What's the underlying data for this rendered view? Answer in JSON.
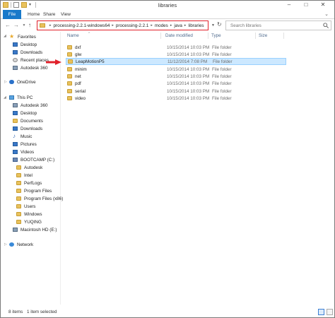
{
  "window": {
    "title": "libraries"
  },
  "ribbon": {
    "file": "File",
    "home": "Home",
    "share": "Share",
    "view": "View"
  },
  "address": {
    "crumbs": [
      "processing-2.2.1-windows64",
      "processing-2.2.1",
      "modes",
      "java",
      "libraries"
    ],
    "highlight_color": "#e0202a"
  },
  "search": {
    "placeholder": "Search libraries"
  },
  "nav": {
    "favorites": "Favorites",
    "desktop": "Desktop",
    "downloads": "Downloads",
    "recent": "Recent places",
    "autodesk360_fav": "Autodesk 360",
    "onedrive": "OneDrive",
    "thispc": "This PC",
    "autodesk360": "Autodesk 360",
    "pc_desktop": "Desktop",
    "documents": "Documents",
    "pc_downloads": "Downloads",
    "music": "Music",
    "pictures": "Pictures",
    "videos": "Videos",
    "bootcamp": "BOOTCAMP (C:)",
    "c_autodesk": "Autodesk",
    "c_intel": "Intel",
    "c_perflogs": "PerfLogs",
    "c_programfiles": "Program Files",
    "c_programfilesx86": "Program Files (x86)",
    "c_users": "Users",
    "c_windows": "Windows",
    "c_yuqing": "YUQING",
    "macintosh": "Macintosh HD (E:)",
    "network": "Network"
  },
  "columns": {
    "name": "Name",
    "date": "Date modified",
    "type": "Type",
    "size": "Size"
  },
  "files": [
    {
      "name": "dxf",
      "date": "10/15/2014 10:03 PM",
      "type": "File folder"
    },
    {
      "name": "glw",
      "date": "10/15/2014 10:03 PM",
      "type": "File folder"
    },
    {
      "name": "LeapMotionP5",
      "date": "11/12/2014 7:08 PM",
      "type": "File folder"
    },
    {
      "name": "minim",
      "date": "10/15/2014 10:03 PM",
      "type": "File folder"
    },
    {
      "name": "net",
      "date": "10/15/2014 10:03 PM",
      "type": "File folder"
    },
    {
      "name": "pdf",
      "date": "10/15/2014 10:03 PM",
      "type": "File folder"
    },
    {
      "name": "serial",
      "date": "10/15/2014 10:03 PM",
      "type": "File folder"
    },
    {
      "name": "video",
      "date": "10/15/2014 10:03 PM",
      "type": "File folder"
    }
  ],
  "status": {
    "count": "8 items",
    "selected": "1 item selected"
  },
  "colors": {
    "accent": "#1979ca",
    "selection": "#cce8ff",
    "arrow": "#e0202a"
  }
}
